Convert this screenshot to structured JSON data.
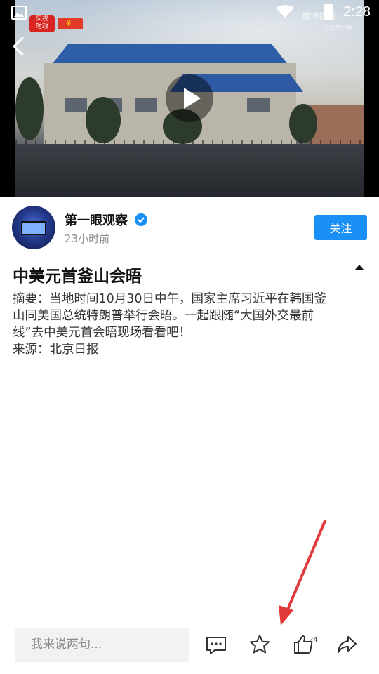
{
  "status_bar": {
    "time": "2:28"
  },
  "video": {
    "channel_logo_text": "央视\n时政",
    "watermark": "微博视频",
    "watermark_sub": "@北京日报"
  },
  "author": {
    "name": "第一眼观察",
    "time": "23小时前",
    "follow_label": "关注"
  },
  "article": {
    "title": "中美元首釜山会晤",
    "lines": [
      "摘要：当地时间10月30日中午，国家主席习近平在韩国釜",
      "山同美国总统特朗普举行会晤。一起跟随“大国外交最前",
      "线”去中美元首会晤现场看看吧！",
      "来源：北京日报"
    ]
  },
  "bottom_bar": {
    "comment_placeholder": "我来说两句...",
    "like_count": "24"
  },
  "colors": {
    "accent": "#1a8ff5",
    "annotation_arrow": "#e23a3a"
  },
  "icons": [
    "gallery-icon",
    "wifi-icon",
    "battery-icon",
    "back-icon",
    "play-icon",
    "verified-icon",
    "collapse-icon",
    "comment-icon",
    "star-icon",
    "like-icon",
    "share-icon"
  ]
}
